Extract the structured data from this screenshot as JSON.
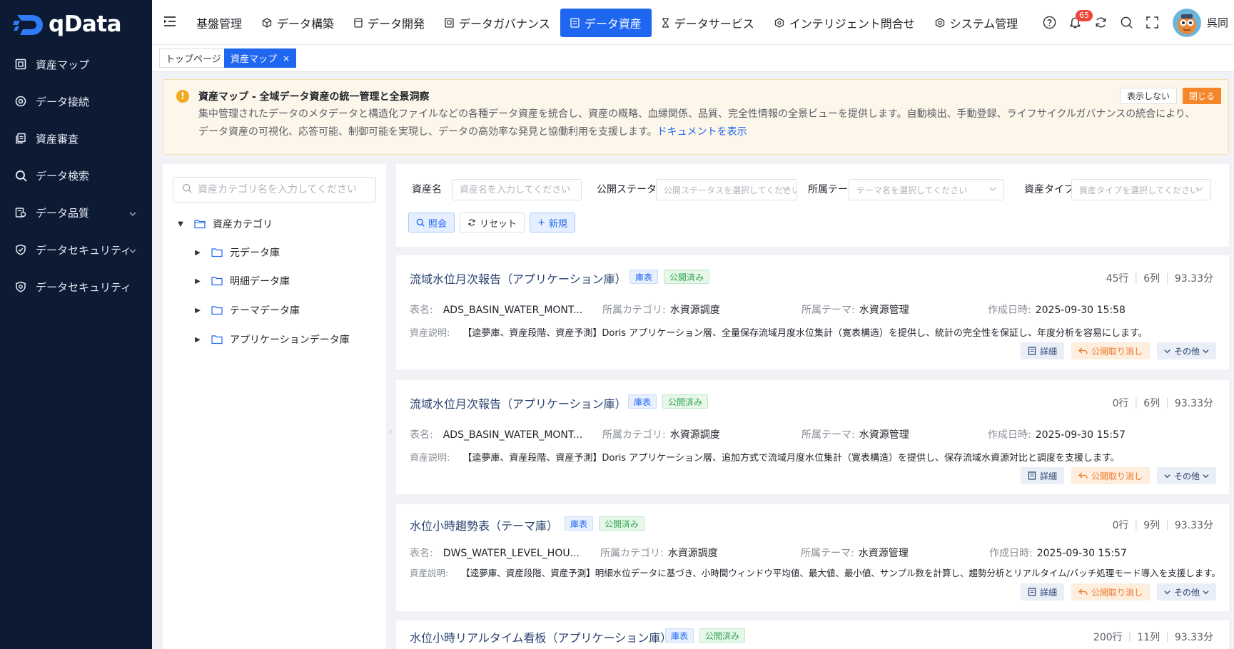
{
  "app": {
    "name": "qData",
    "user": "呉同",
    "notification_count": "65"
  },
  "sidebar": {
    "items": [
      {
        "label": "資産マップ",
        "icon": "asset-map-icon"
      },
      {
        "label": "データ接続",
        "icon": "target-icon"
      },
      {
        "label": "資産審査",
        "icon": "copy-icon"
      },
      {
        "label": "データ検索",
        "icon": "search-icon"
      },
      {
        "label": "データ品質",
        "icon": "quality-icon",
        "expandable": true
      },
      {
        "label": "データセキュリティ",
        "icon": "shield-icon",
        "expandable": true
      },
      {
        "label": "データセキュリティ",
        "icon": "settings-shield-icon"
      }
    ]
  },
  "topnav": {
    "items": [
      {
        "label": "基盤管理",
        "icon": ""
      },
      {
        "label": "データ構築",
        "icon": "cube-icon"
      },
      {
        "label": "データ開発",
        "icon": "database-icon"
      },
      {
        "label": "データガバナンス",
        "icon": "governance-icon"
      },
      {
        "label": "データ資産",
        "icon": "asset-icon",
        "active": true
      },
      {
        "label": "データサービス",
        "icon": "hourglass-icon"
      },
      {
        "label": "インテリジェント問合せ",
        "icon": "hex-icon"
      },
      {
        "label": "システム管理",
        "icon": "gear-icon"
      }
    ]
  },
  "tabs": {
    "home": "トップページ",
    "current": "資産マップ",
    "close_glyph": "×"
  },
  "notice": {
    "title": "資産マップ - 全域データ資産の統一管理と全景洞察",
    "body": "集中管理されたデータのメタデータと構造化ファイルなどの各種データ資産を統合し、資産の概略、血縁関係、品質、完全性情報の全景ビューを提供します。自動検出、手動登録、ライフサイクルガバナンスの統合により、データ資産の可視化、応答可能、制御可能を実現し、データの高効率な発見と協働利用を支援します。",
    "link": "ドキュメントを表示",
    "hide_label": "表示しない",
    "close_label": "閉じる"
  },
  "tree": {
    "search_placeholder": "資産カテゴリ名を入力してください",
    "root": "資産カテゴリ",
    "children": [
      "元データ庫",
      "明細データ庫",
      "テーマデータ庫",
      "アプリケーションデータ庫"
    ]
  },
  "filters": {
    "name_label": "資産名",
    "name_placeholder": "資産名を入力してください",
    "status_label": "公開ステータス",
    "status_placeholder": "公開ステータスを選択してください",
    "theme_label": "所属テーマ",
    "theme_placeholder": "テーマ名を選択してください",
    "type_label": "資産タイプ",
    "type_placeholder": "資産タイプを選択してください",
    "query_label": "照会",
    "reset_label": "リセット",
    "new_label": "新規"
  },
  "labels": {
    "table": "表名:",
    "category": "所属カテゴリ:",
    "theme": "所属テーマ:",
    "created": "作成日時:",
    "desc": "資産説明:",
    "detail": "詳細",
    "unpublish": "公開取り消し",
    "more": "その他"
  },
  "assets": [
    {
      "title": "流域水位月次報告（アプリケーション庫）",
      "type_tag": "庫表",
      "status_tag": "公開済み",
      "rows": "45行",
      "cols": "6列",
      "score": "93.33分",
      "table": "ADS_BASIN_WATER_MONT...",
      "category": "水資源調度",
      "theme": "水資源管理",
      "created": "2025-09-30 15:58",
      "desc": "【逵夢庫、資産段階、資産予測】Doris アプリケーション層、全量保存流域月度水位集計（寛表構造）を提供し、統計の完全性を保証し、年度分析を容易にします。"
    },
    {
      "title": "流域水位月次報告（アプリケーション庫）",
      "type_tag": "庫表",
      "status_tag": "公開済み",
      "rows": "0行",
      "cols": "6列",
      "score": "93.33分",
      "table": "ADS_BASIN_WATER_MONT...",
      "category": "水資源調度",
      "theme": "水資源管理",
      "created": "2025-09-30 15:57",
      "desc": "【逵夢庫、資産段階、資産予測】Doris アプリケーション層、追加方式で流域月度水位集計（寛表構造）を提供し、保存流域水資源対比と調度を支援します。"
    },
    {
      "title": "水位小時趨勢表（テーマ庫）",
      "type_tag": "庫表",
      "status_tag": "公開済み",
      "rows": "0行",
      "cols": "9列",
      "score": "93.33分",
      "table": "DWS_WATER_LEVEL_HOU...",
      "category": "水資源調度",
      "theme": "水資源管理",
      "created": "2025-09-30 15:57",
      "desc": "【逵夢庫、資産段階、資産予測】明細水位データに基づき、小時間ウィンドウ平均値、最大値、最小値、サンプル数を計算し、趨勢分析とリアルタイム/バッチ処理モード導入を支援します。"
    },
    {
      "title": "水位小時リアルタイム看板（アプリケーション庫）",
      "type_tag": "庫表",
      "status_tag": "公開済み",
      "rows": "200行",
      "cols": "11列",
      "score": "93.33分"
    }
  ],
  "colors": {
    "sidebar_bg": "#0c1a33",
    "primary": "#1f66f0",
    "orange": "#f5862a",
    "green": "#2ea44f"
  }
}
